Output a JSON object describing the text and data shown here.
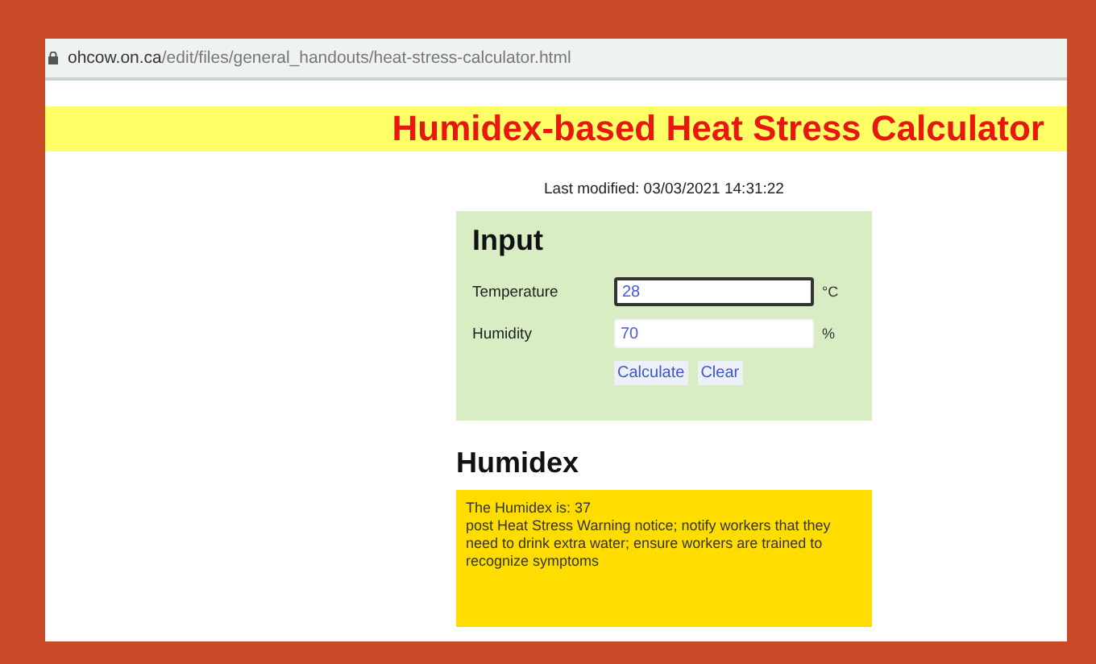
{
  "address_bar": {
    "host": "ohcow.on.ca",
    "path": "/edit/files/general_handouts/heat-stress-calculator.html"
  },
  "banner": {
    "title": "Humidex-based Heat Stress Calculator"
  },
  "last_modified": "Last modified: 03/03/2021 14:31:22",
  "input_panel": {
    "title": "Input",
    "fields": [
      {
        "label": "Temperature",
        "value": "28",
        "unit": "°C",
        "focused": true
      },
      {
        "label": "Humidity",
        "value": "70",
        "unit": "%",
        "focused": false
      }
    ],
    "buttons": [
      "Calculate",
      "Clear"
    ]
  },
  "result": {
    "title": "Humidex",
    "lines": [
      "The Humidex is: 37",
      "post Heat Stress Warning notice; notify workers that they need to drink extra water; ensure workers are trained to recognize symptoms"
    ]
  }
}
